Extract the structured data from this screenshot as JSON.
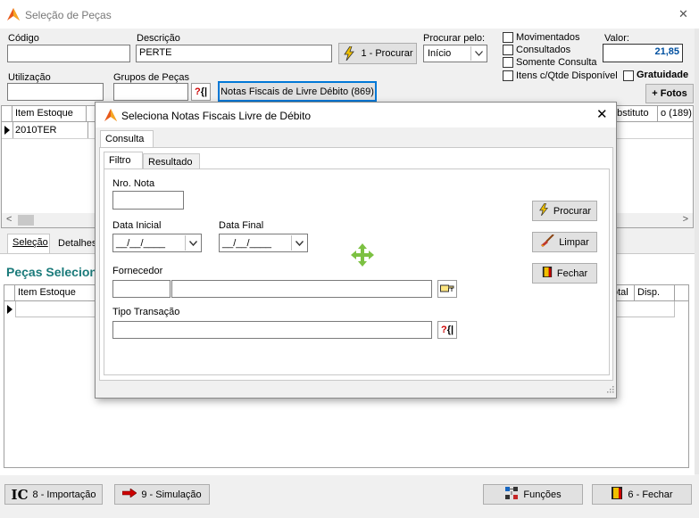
{
  "window": {
    "title": "Seleção de Peças",
    "close": "✕"
  },
  "filters": {
    "codigo_label": "Código",
    "codigo_value": "",
    "descricao_label": "Descrição",
    "descricao_value": "PERTE",
    "procurar_label": "1 - Procurar",
    "procurar_pelo_label": "Procurar pelo:",
    "procurar_pelo_value": "Início",
    "utilizacao_label": "Utilização",
    "grupos_label": "Grupos de Peças",
    "notas_button": "Notas Fiscais de Livre Débito (869)",
    "valor_label": "Valor:",
    "valor_value": "21,85",
    "checks": {
      "movimentados": "Movimentados",
      "consultados": "Consultados",
      "somente_consulta": "Somente Consulta",
      "itens_qtde": "Itens c/Qtde Disponível",
      "gratuidade": "Gratuidade"
    },
    "fotos_button": "+ Fotos"
  },
  "top_grid": {
    "col_item": "Item Estoque",
    "col_substituto": "ubstituto",
    "col_last": "o (189)",
    "row_value": "2010TER"
  },
  "tabs": {
    "selecao": "Seleção",
    "detalhes": "Detalhes"
  },
  "selected": {
    "title": "Peças Seleciona",
    "col_item": "Item Estoque",
    "col_total": "otal",
    "col_disp": "Disp."
  },
  "bottom": {
    "importacao": "8 - Importação",
    "simulacao": "9 - Simulação",
    "funcoes": "Funções",
    "fechar": "6 - Fechar"
  },
  "dialog": {
    "title": "Seleciona Notas Fiscais Livre de Débito",
    "tab_consulta": "Consulta",
    "tab_filtro": "Filtro",
    "tab_resultado": "Resultado",
    "nro_nota_label": "Nro. Nota",
    "data_inicial_label": "Data Inicial",
    "data_inicial_value": "__/__/____",
    "data_final_label": "Data Final",
    "data_final_value": "__/__/____",
    "fornecedor_label": "Fornecedor",
    "tipo_transacao_label": "Tipo Transação",
    "procurar": "Procurar",
    "limpar": "Limpar",
    "fechar": "Fechar"
  },
  "colors": {
    "accent_blue": "#0078d7",
    "teal_title": "#1a7a7a",
    "lightning": "#f0c000"
  }
}
